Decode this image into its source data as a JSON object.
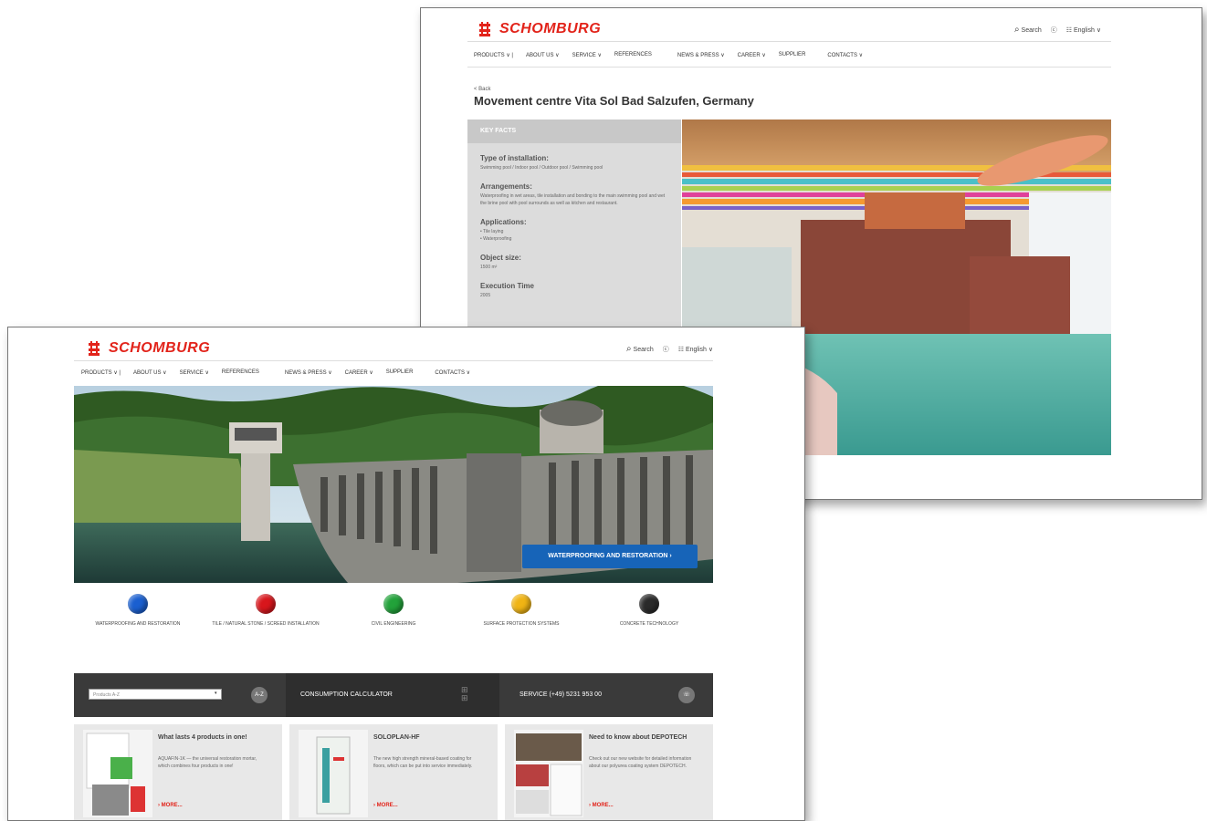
{
  "brand": {
    "name": "SCHOMBURG",
    "color": "#e2231a"
  },
  "utils": {
    "search": "Search",
    "contact": "ⓒ",
    "language": "English"
  },
  "nav": {
    "items": [
      "PRODUCTS ∨ |",
      "ABOUT US ∨",
      "SERVICE ∨",
      "REFERENCES",
      "NEWS & PRESS ∨",
      "CAREER ∨",
      "SUPPLIER",
      "CONTACTS ∨"
    ]
  },
  "reference_page": {
    "back": "< Back",
    "title": "Movement centre Vita Sol Bad Salzufen, Germany",
    "facts_heading": "KEY FACTS",
    "facts": [
      {
        "label": "Type of installation:",
        "value": "Swimming pool / Indoor pool / Outdoor pool / Swimming pool"
      },
      {
        "label": "Arrangements:",
        "value": "Waterproofing in wet areas, tile installation and bonding to the main swimming pool and wet the brine pool with pool surrounds as well as kitchen and restaurant."
      },
      {
        "label": "Applications:",
        "value": "• Tile laying\n• Waterproofing"
      },
      {
        "label": "Object size:",
        "value": "1500 m²"
      },
      {
        "label": "Execution Time",
        "value": "2005"
      }
    ]
  },
  "home_page": {
    "hero_cta": "WATERPROOFING AND RESTORATION  ›",
    "categories": [
      {
        "label": "WATERPROOFING AND RESTORATION",
        "color": "#1a5fd0"
      },
      {
        "label": "TILE / NATURAL STONE / SCREED INSTALLATION",
        "color": "#d8161c"
      },
      {
        "label": "CIVIL ENGINEERING",
        "color": "#22a23a"
      },
      {
        "label": "SURFACE PROTECTION SYSTEMS",
        "color": "#f0b414"
      },
      {
        "label": "CONCRETE TECHNOLOGY",
        "color": "#2a2a2a"
      }
    ],
    "toolbar": {
      "select_placeholder": "Products A-Z",
      "az_button": "A-Z",
      "calculator": "CONSUMPTION CALCULATOR",
      "service": "SERVICE (+49) 5231 953 00"
    },
    "cards": [
      {
        "title": "What lasts 4 products in one!",
        "text": "AQUAFIN-1K — the universal restoration mortar, which combines four products in one!",
        "more": "›  MORE..."
      },
      {
        "title": "SOLOPLAN-HF",
        "text": "The new high strength mineral-based coating for floors, which can be put into service immediately.",
        "more": "›  MORE..."
      },
      {
        "title": "Need to know about DEPOTECH",
        "text": "Check out our new website for detailed information about our polyurea coating system DEPOTECH.",
        "more": "›  MORE..."
      }
    ]
  }
}
